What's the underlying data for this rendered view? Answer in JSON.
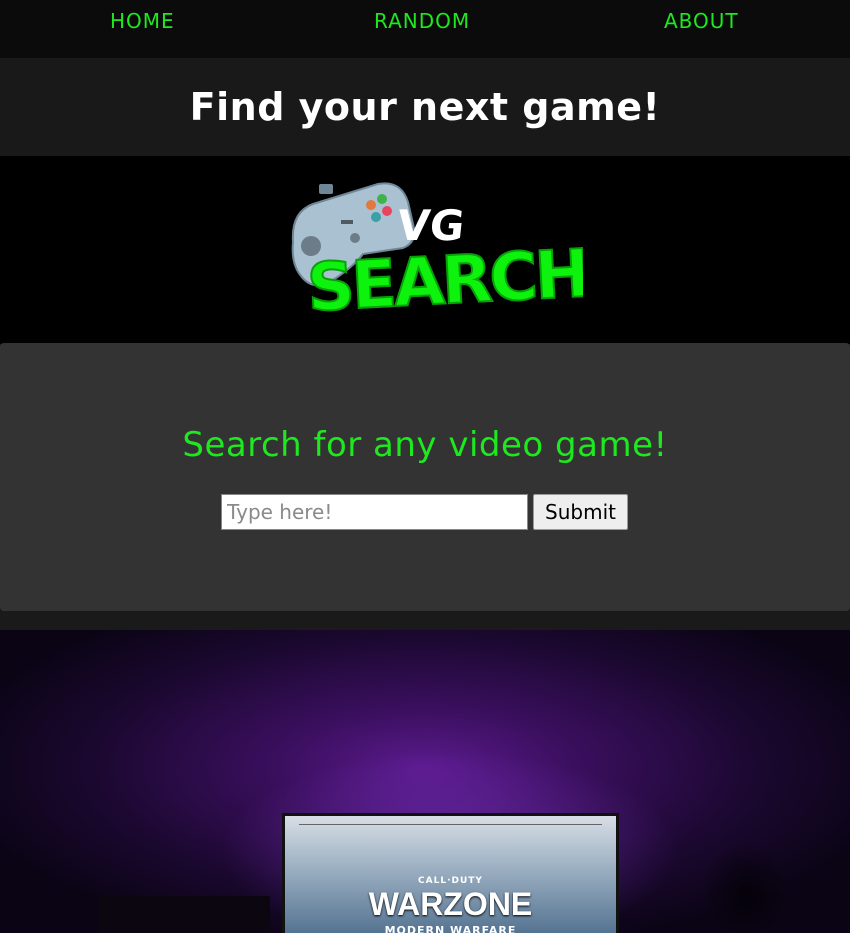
{
  "nav": {
    "home": "HOME",
    "random": "RANDOM",
    "about": "ABOUT"
  },
  "header": {
    "title": "Find your next game!"
  },
  "logo": {
    "small_text": "VG",
    "main_text": "SEARCH"
  },
  "search": {
    "heading": "Search for any video game!",
    "placeholder": "Type here!",
    "value": "",
    "submit_label": "Submit"
  },
  "hero": {
    "screen_subtitle": "CALL·DUTY",
    "screen_title": "WARZONE",
    "screen_tagline": "MODERN WARFARE"
  },
  "colors": {
    "accent_green": "#1ee81e",
    "nav_bg": "#0b0b0b",
    "panel_bg": "#333333"
  }
}
